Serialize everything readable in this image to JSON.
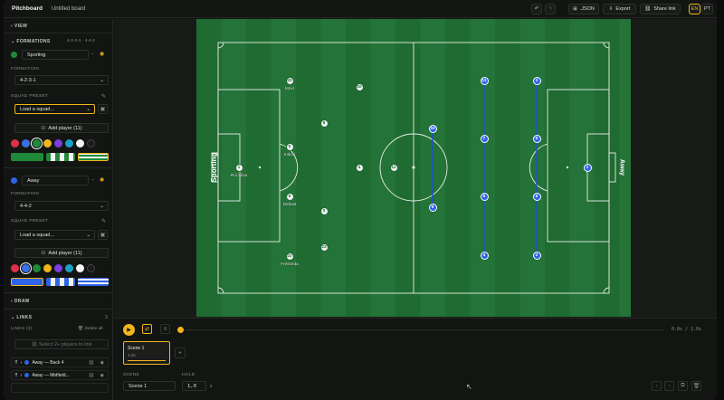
{
  "app": {
    "name": "Pitchboard",
    "board_name": "Untitled board"
  },
  "toolbar": {
    "json_label": ".JSON",
    "export_label": "Export",
    "share_label": "Share link",
    "lang_en": "EN",
    "lang_pt": "PT"
  },
  "sidebar": {
    "view_label": "VIEW",
    "formations_label": "FORMATIONS",
    "formations_summary": "4-2-3-1 · 4-4-2",
    "home": {
      "team_name": "Sporting",
      "formation_label": "FORMATION",
      "formation": "4-2-3-1",
      "preset_label": "SQUAD PRESET",
      "preset_placeholder": "Load a squad...",
      "add_player": "Add player (11)",
      "color": "#1f8a3a"
    },
    "away": {
      "team_name": "Away",
      "formation_label": "FORMATION",
      "formation": "4-4-2",
      "preset_label": "SQUAD PRESET",
      "preset_placeholder": "Load a squad...",
      "add_player": "Add player (11)",
      "color": "#2d64e8"
    },
    "draw_label": "DRAW",
    "links_label": "LINKS",
    "links_count": "3",
    "links_sub": "LINKS (3)",
    "delete_all": "Delete all",
    "select_hint": "Select 2+ players to link",
    "link_items": [
      "Away — Back 4",
      "Away — Midfield..."
    ]
  },
  "pitch": {
    "home_label": "Sporting",
    "away_label": "Away",
    "home_players": [
      {
        "num": "20",
        "name": "Moví"
      },
      {
        "num": "10",
        "name": ""
      },
      {
        "num": "8",
        "name": ""
      },
      {
        "num": "5",
        "name": "Inácio"
      },
      {
        "num": "1",
        "name": "Rui Silva"
      },
      {
        "num": "4",
        "name": ""
      },
      {
        "num": "11",
        "name": ""
      },
      {
        "num": "9",
        "name": "Debast"
      },
      {
        "num": "3",
        "name": ""
      },
      {
        "num": "22",
        "name": "Fresneda"
      },
      {
        "num": "23",
        "name": ""
      }
    ],
    "away_players": [
      "11",
      "3",
      "10",
      "7",
      "6",
      "1",
      "8",
      "5",
      "9",
      "4",
      "2"
    ]
  },
  "timeline": {
    "time": "0.0s / 1.0s"
  },
  "scenes": [
    {
      "name": "Scene 1",
      "duration": "1.0s"
    }
  ],
  "scene_panel": {
    "scene_label": "SCENE",
    "hold_label": "HOLD",
    "scene_value": "Scene 1",
    "hold_value": "1,0",
    "hold_unit": "s"
  },
  "colors": {
    "accent": "#f2b51c",
    "pitch_dark": "#1f6b31",
    "pitch_light": "#247338",
    "away": "#2d64e8",
    "link_line": "#1f4fd8"
  },
  "swatches": [
    "#e0304a",
    "#3b6fe8",
    "#1f8a3a",
    "#f2b51c",
    "#7b3fe0",
    "#1aa1c9",
    "#f4f4f4",
    "#1b1b1b"
  ]
}
